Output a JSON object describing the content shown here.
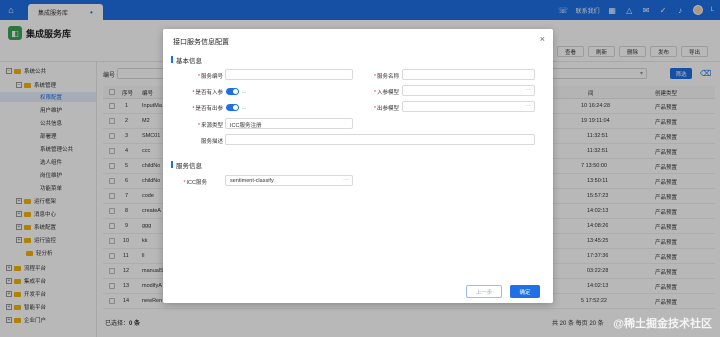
{
  "topbar": {
    "tab_label": "集成服务库",
    "right_link": "联系我们",
    "user_initial": "L"
  },
  "page": {
    "title": "集成服务库",
    "toolbar": [
      "查看",
      "刷新",
      "删除",
      "发布",
      "导出"
    ]
  },
  "sidebar": {
    "items": [
      {
        "label": "系统公共",
        "level": 0,
        "expander": "−"
      },
      {
        "label": "系统管理",
        "level": 1,
        "expander": "−"
      },
      {
        "label": "权限配置",
        "level": 2,
        "selected": true
      },
      {
        "label": "用户维护",
        "level": 2
      },
      {
        "label": "公共信息",
        "level": 2
      },
      {
        "label": "部署理",
        "level": 2
      },
      {
        "label": "系统管理公共",
        "level": 2
      },
      {
        "label": "选人组件",
        "level": 2
      },
      {
        "label": "岗位维护",
        "level": 2
      },
      {
        "label": "功能菜单",
        "level": 2
      },
      {
        "label": "运行框架",
        "level": 1,
        "expander": "+"
      },
      {
        "label": "消息中心",
        "level": 1,
        "expander": "+"
      },
      {
        "label": "系统配置",
        "level": 1,
        "expander": "+"
      },
      {
        "label": "运行监控",
        "level": 1,
        "expander": "+"
      },
      {
        "label": "轻分析",
        "level": 1
      },
      {
        "label": "流程平台",
        "level": 0,
        "expander": "+"
      },
      {
        "label": "集成平台",
        "level": 0,
        "expander": "+"
      },
      {
        "label": "开发平台",
        "level": 0,
        "expander": "+"
      },
      {
        "label": "智能平台",
        "level": 0,
        "expander": "+"
      },
      {
        "label": "企业门户",
        "level": 0,
        "expander": "+"
      }
    ]
  },
  "filter": {
    "label": "编号",
    "search_label": "筛选"
  },
  "table": {
    "headers": {
      "index": "序号",
      "code": "编号",
      "time": "间",
      "type": "创建类型"
    },
    "rows": [
      {
        "index": "1",
        "code": "InputMa",
        "time": "10 16:24:28",
        "type": "产品预置"
      },
      {
        "index": "2",
        "code": "M2",
        "time": "19 19:11:04",
        "type": "产品预置"
      },
      {
        "index": "3",
        "code": "SMC01",
        "time": "11:32:51",
        "type": "产品预置"
      },
      {
        "index": "4",
        "code": "ccc",
        "time": "11:32:51",
        "type": "产品预置"
      },
      {
        "index": "5",
        "code": "childNo",
        "time": "7 13:50:00",
        "type": "产品预置"
      },
      {
        "index": "6",
        "code": "childNo",
        "time": "13:50:11",
        "type": "产品预置"
      },
      {
        "index": "7",
        "code": "code",
        "time": "15:57:23",
        "type": "产品预置"
      },
      {
        "index": "8",
        "code": "createA",
        "time": "14:02:13",
        "type": "产品预置"
      },
      {
        "index": "9",
        "code": "ggg",
        "time": "14:08:26",
        "type": "产品预置"
      },
      {
        "index": "10",
        "code": "kk",
        "time": "13:45:25",
        "type": "产品预置"
      },
      {
        "index": "11",
        "code": "ll",
        "time": "17:37:36",
        "type": "产品预置"
      },
      {
        "index": "12",
        "code": "manualS",
        "time": "03:22:28",
        "type": "产品预置"
      },
      {
        "index": "13",
        "code": "modifyA",
        "time": "14:02:13",
        "type": "产品预置"
      },
      {
        "index": "14",
        "code": "newRen",
        "time": "5 17:52:22",
        "type": "产品预置"
      }
    ],
    "footer_selected_label": "已选择：",
    "footer_selected_count": "0 条",
    "footer_total": "共 20 条   每页 20 条"
  },
  "dialog": {
    "title": "接口服务信息配置",
    "basic_section": "基本信息",
    "service_section": "服务信息",
    "fields": {
      "service_code": "服务编号",
      "service_name": "服务名称",
      "has_input": "是否有入参",
      "input_model": "入参模型",
      "has_output": "是否有出参",
      "output_model": "出参模型",
      "source_type": "来源类型",
      "source_type_value": "ICC服务注册",
      "service_desc": "服务描述",
      "icc_service": "ICC服务",
      "icc_service_value": "sentiment-classify"
    },
    "prev_label": "上一步",
    "ok_label": "确定"
  },
  "watermark": "@稀土掘金技术社区"
}
